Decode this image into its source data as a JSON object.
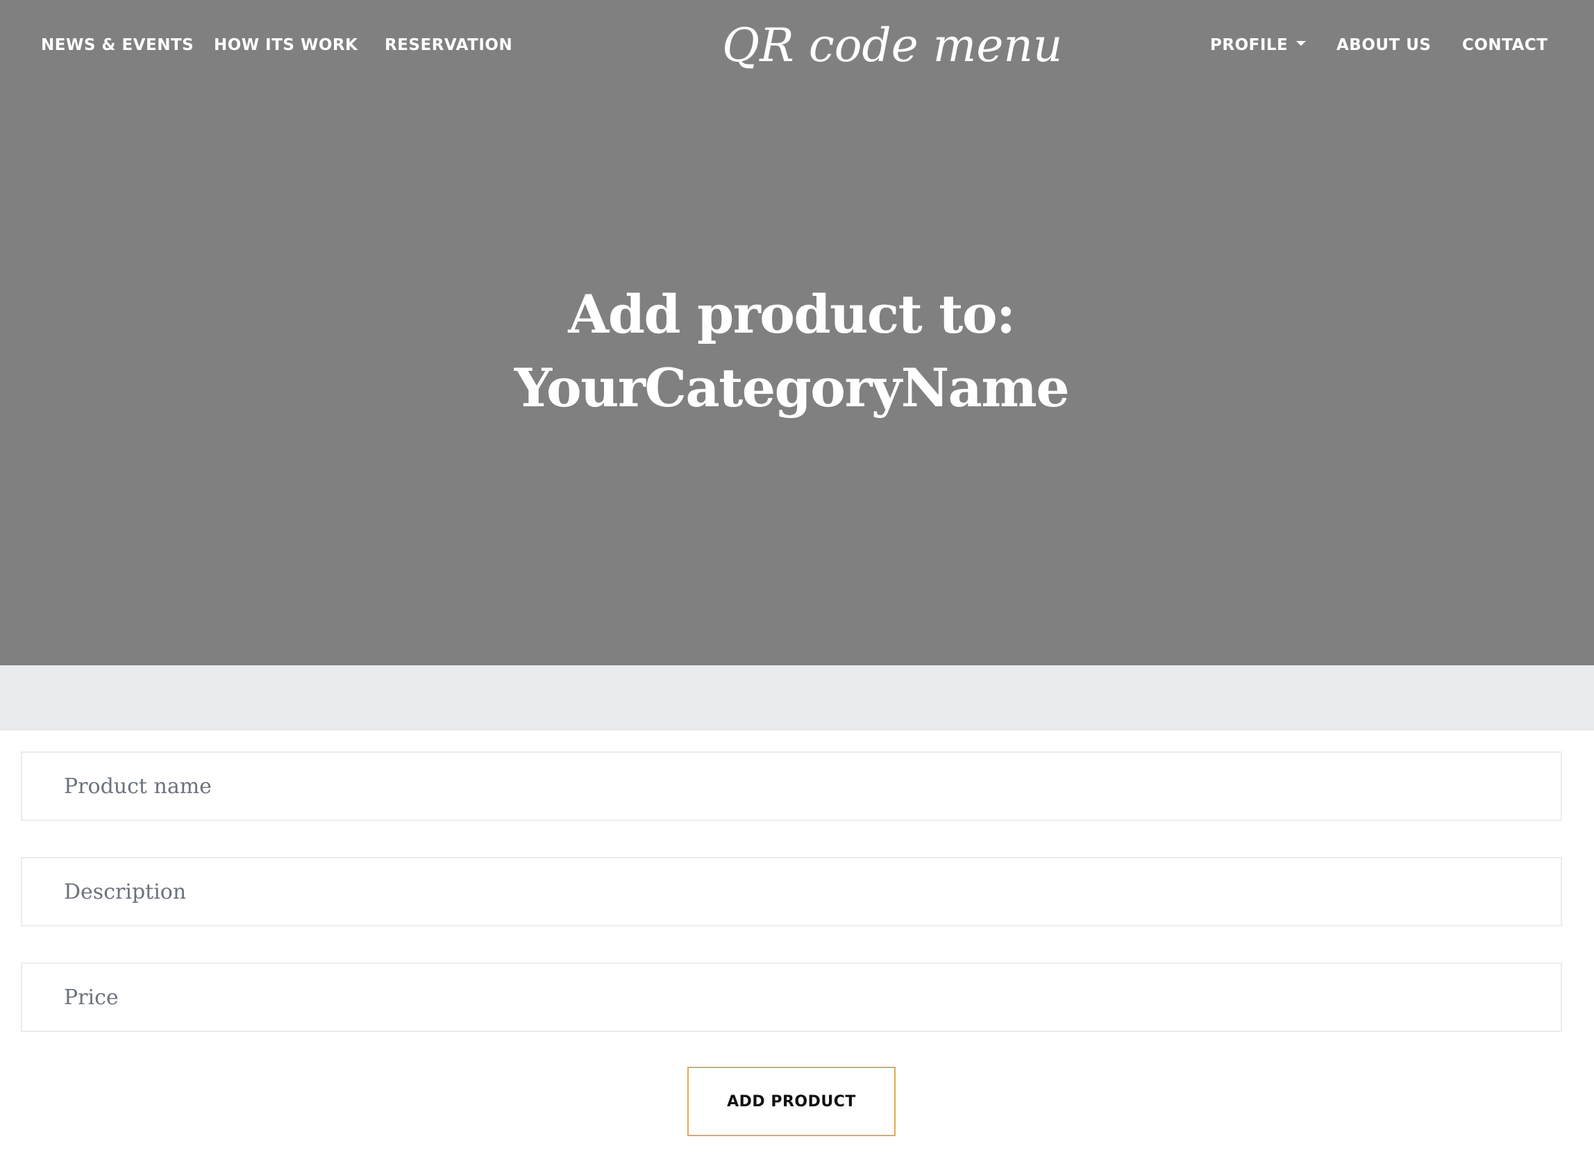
{
  "navbar": {
    "left_links": [
      {
        "label": "NEWS & EVENTS"
      },
      {
        "label": "HOW ITS WORK"
      },
      {
        "label": "RESERVATION"
      }
    ],
    "brand": "QR code menu",
    "right_links": [
      {
        "label": "PROFILE",
        "has_dropdown": true,
        "icon": "caret-down-icon"
      },
      {
        "label": "ABOUT US"
      },
      {
        "label": "CONTACT"
      }
    ]
  },
  "hero": {
    "title_line1": "Add product to:",
    "title_line2": "YourCategoryName"
  },
  "form": {
    "product_name": {
      "placeholder": "Product name",
      "value": ""
    },
    "description": {
      "placeholder": "Description",
      "value": ""
    },
    "price": {
      "placeholder": "Price",
      "value": ""
    },
    "submit_label": "ADD PRODUCT"
  },
  "colors": {
    "hero_background": "#808080",
    "band_background": "#e9ebee",
    "button_border": "#e8a84c"
  }
}
